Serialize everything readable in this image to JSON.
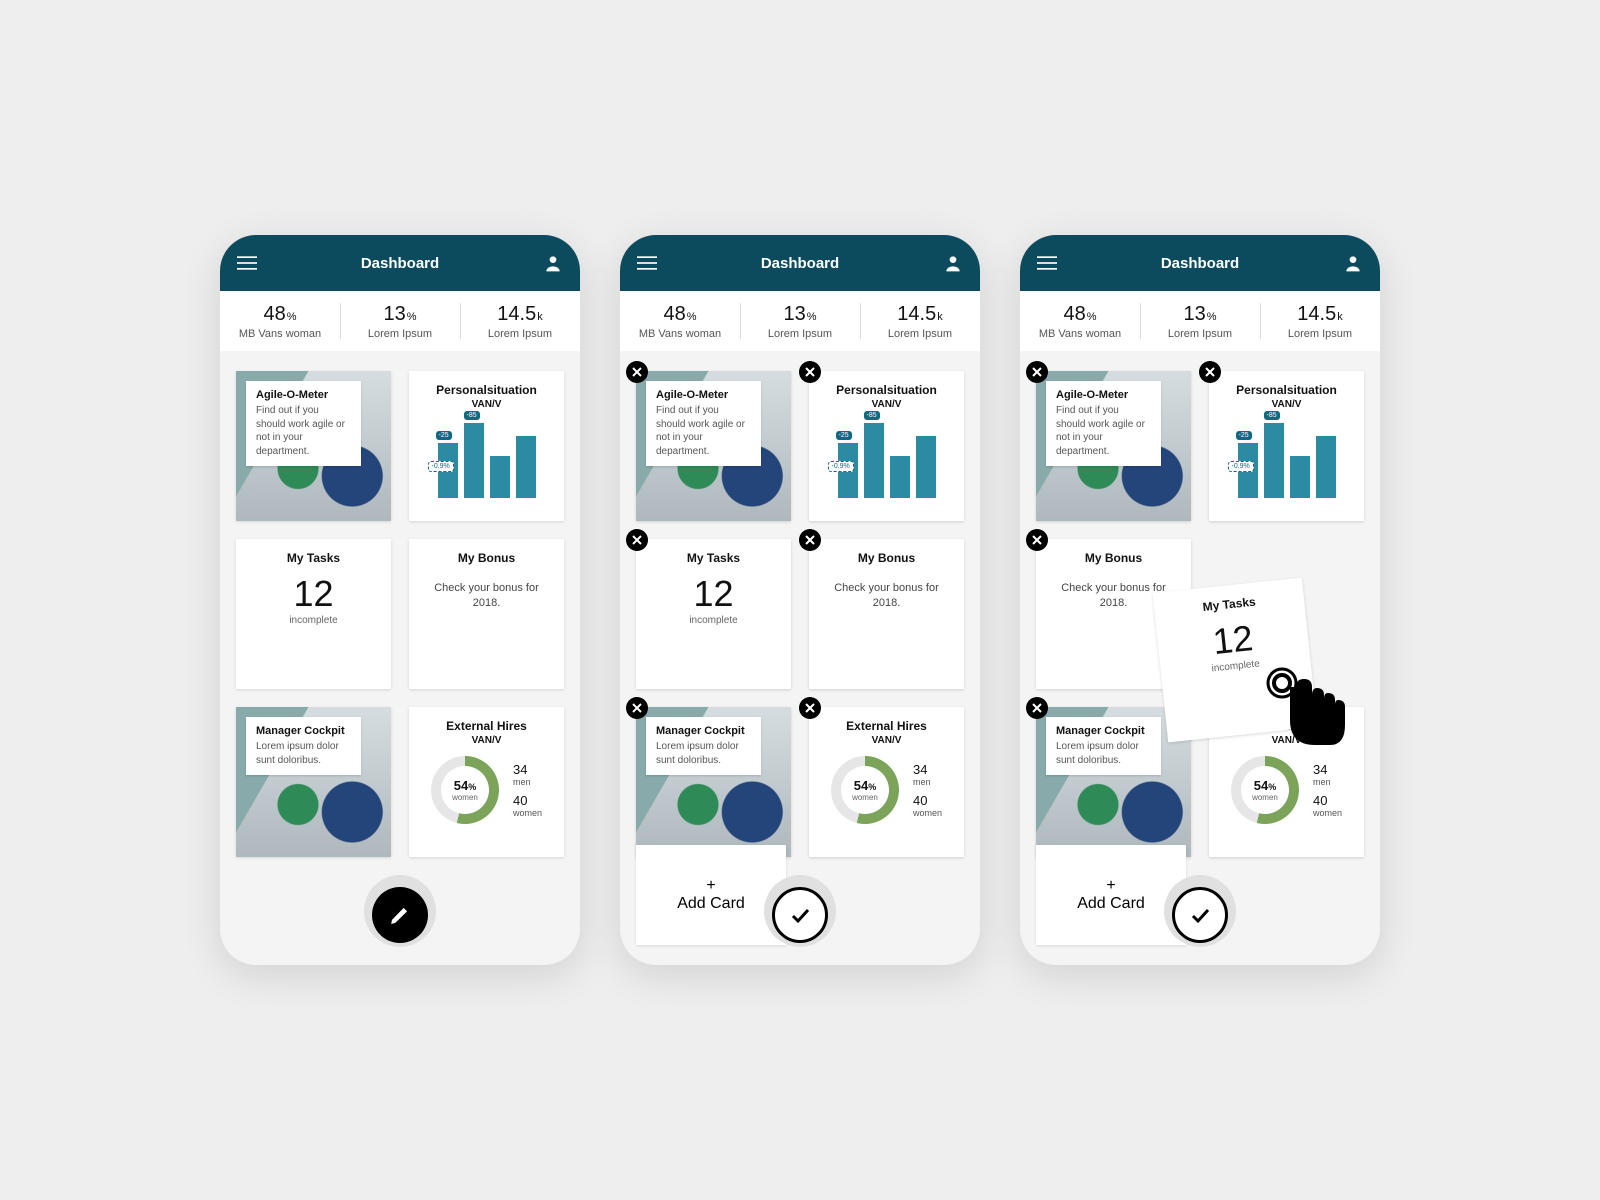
{
  "header": {
    "title": "Dashboard"
  },
  "colors": {
    "primary": "#0c4a5e",
    "chart": "#2d8aa3",
    "donut_fill": "#7ba35a"
  },
  "stats": [
    {
      "value": "48",
      "unit": "%",
      "label": "MB Vans woman"
    },
    {
      "value": "13",
      "unit": "%",
      "label": "Lorem Ipsum"
    },
    {
      "value": "14.5",
      "unit": "k",
      "label": "Lorem Ipsum"
    }
  ],
  "cards": {
    "agile": {
      "title": "Agile-O-Meter",
      "text": "Find out if you should work agile or not in your department."
    },
    "personal": {
      "title": "Personalsituation",
      "sub": "VAN/V",
      "tags": {
        "a": "-25",
        "b": "-85",
        "c": "-0.9%"
      }
    },
    "tasks": {
      "title": "My Tasks",
      "value": "12",
      "sub": "incomplete"
    },
    "bonus": {
      "title": "My Bonus",
      "text": "Check your bonus for 2018."
    },
    "cockpit": {
      "title": "Manager Cockpit",
      "text": "Lorem ipsum dolor sunt doloribus."
    },
    "hires": {
      "title": "External Hires",
      "sub": "VAN/V",
      "donut": "54",
      "donut_unit": "%",
      "donut_label": "women",
      "men": "34",
      "men_label": "men",
      "women": "40",
      "women_label": "women"
    }
  },
  "chart_data": {
    "type": "bar",
    "title": "Personalsituation VAN/V",
    "categories": [
      "",
      "",
      "",
      ""
    ],
    "values": [
      55,
      75,
      42,
      62
    ],
    "annotations": {
      "bar1_top": "-25",
      "bar2_top": "-85",
      "bar1_mid": "-0.9%"
    },
    "ylim": [
      0,
      80
    ]
  },
  "actions": {
    "add_card": "Add Card"
  }
}
